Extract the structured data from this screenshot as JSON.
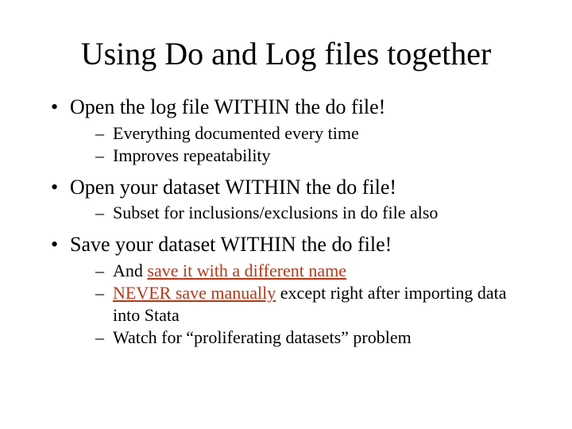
{
  "title": "Using Do and Log files together",
  "b1": {
    "text": "Open the log file WITHIN the do file!",
    "s1": "Everything documented every time",
    "s2": "Improves repeatability"
  },
  "b2": {
    "text": "Open your dataset WITHIN the do file!",
    "s1": "Subset for inclusions/exclusions in do file also"
  },
  "b3": {
    "text": "Save your dataset WITHIN the do file!",
    "s1a": "And ",
    "s1b": "save it with a different name",
    "s2a": "NEVER save manually",
    "s2b": " except right after importing data into Stata",
    "s3": "Watch for “proliferating datasets” problem"
  }
}
